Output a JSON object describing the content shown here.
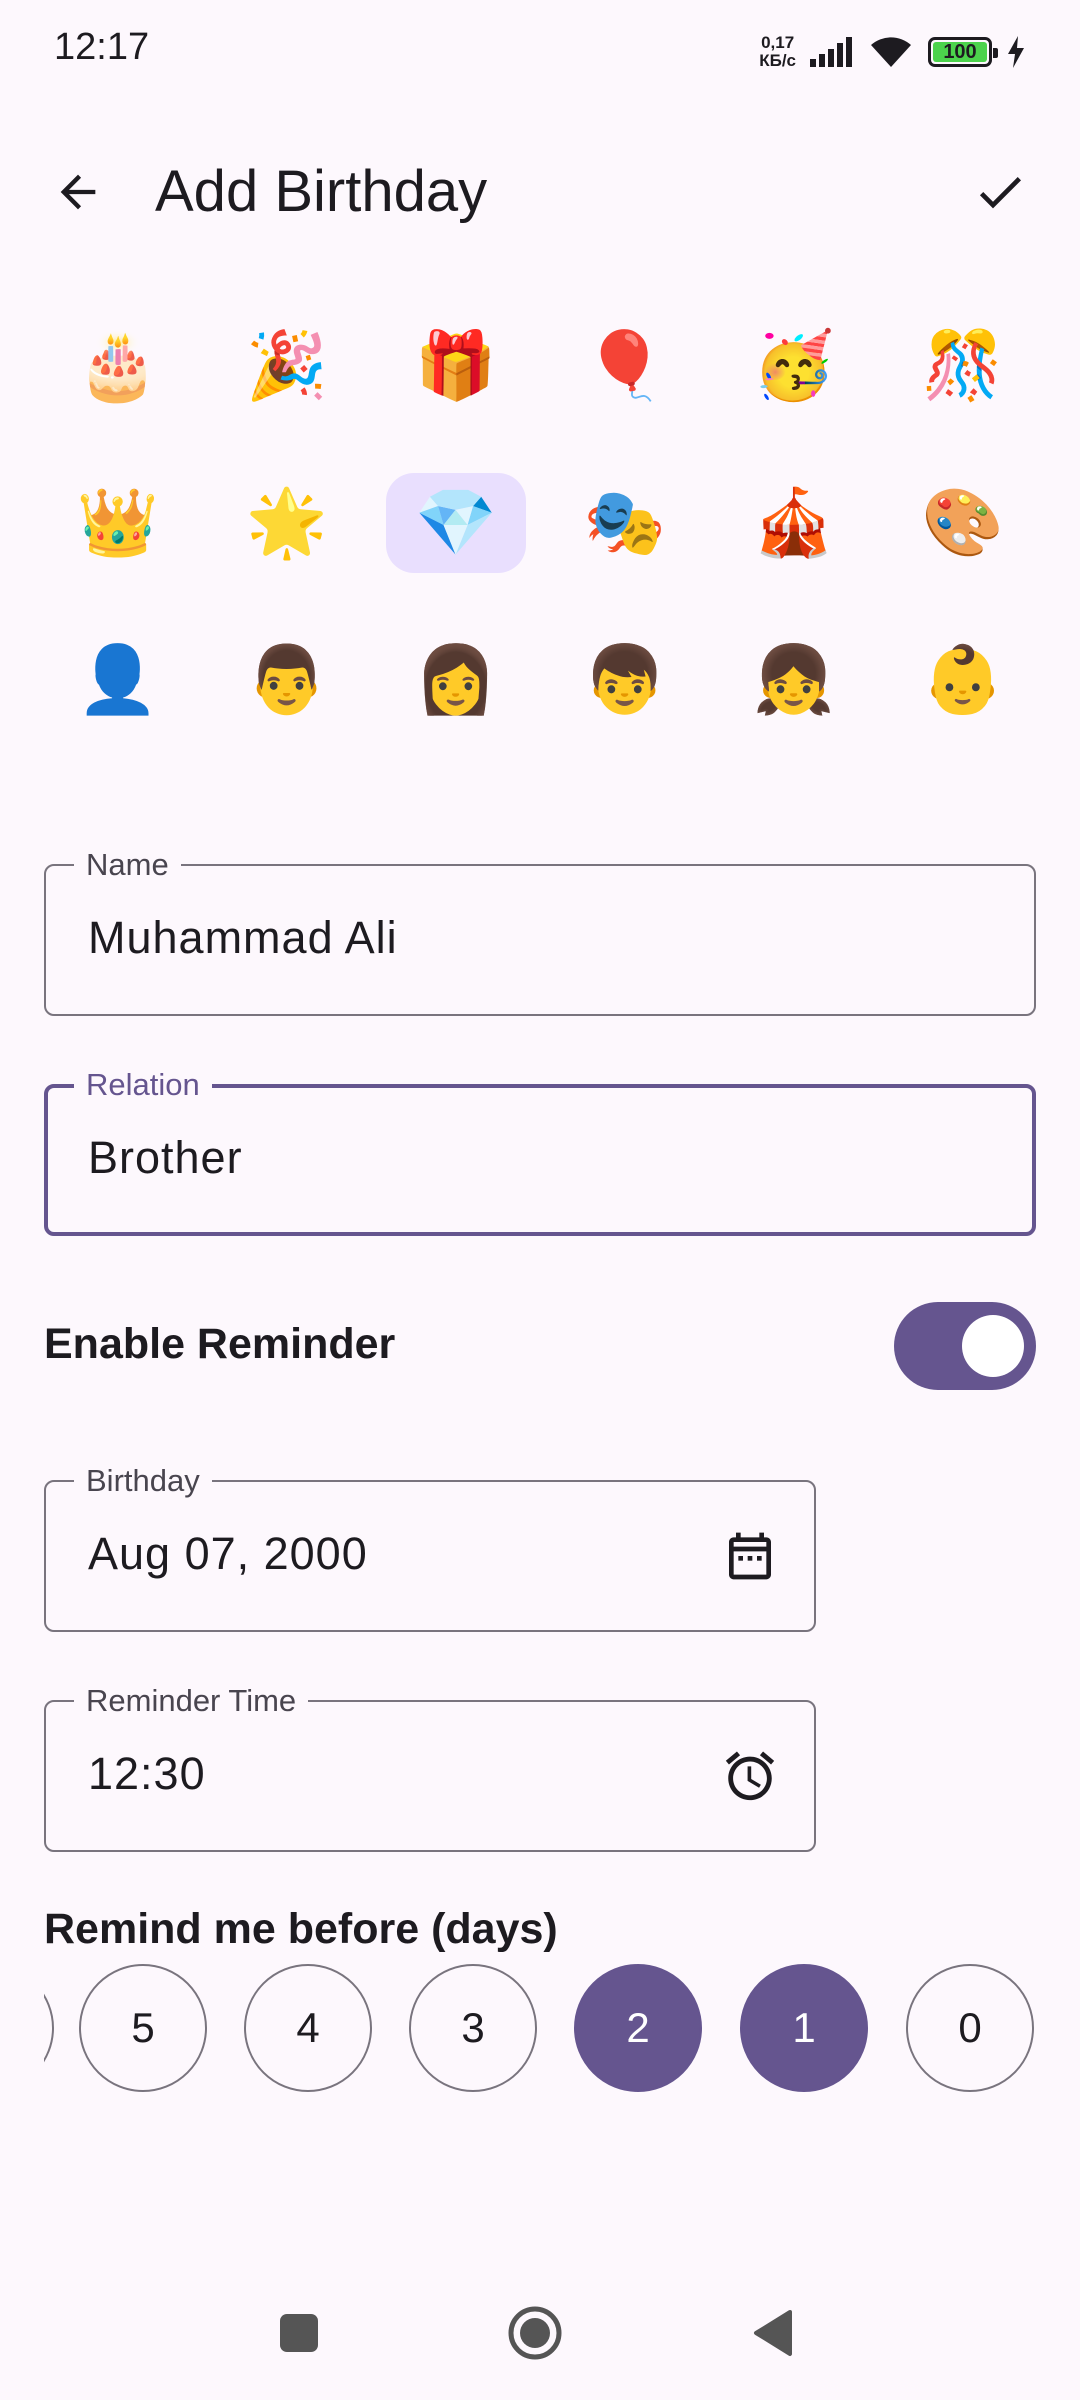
{
  "status_bar": {
    "time": "12:17",
    "net_speed_value": "0,17",
    "net_speed_unit": "КБ/с",
    "battery": "100"
  },
  "app_bar": {
    "title": "Add Birthday",
    "back_icon": "arrow-back-icon",
    "save_icon": "check-icon"
  },
  "emojis": [
    "🎂",
    "🎉",
    "🎁",
    "🎈",
    "🥳",
    "🎊",
    "👑",
    "🌟",
    "💎",
    "🎭",
    "🎪",
    "🎨",
    "👤",
    "👨",
    "👩",
    "👦",
    "👧",
    "👶"
  ],
  "selected_emoji": "💎",
  "form": {
    "name_label": "Name",
    "name_value": "Muhammad Ali",
    "relation_label": "Relation",
    "relation_value": "Brother",
    "reminder_label": "Enable Reminder",
    "reminder_enabled": true,
    "birthday_label": "Birthday",
    "birthday_value": "Aug 07, 2000",
    "birthday_icon": "calendar-icon",
    "time_label": "Reminder Time",
    "time_value": "12:30",
    "time_icon": "alarm-icon",
    "days_title": "Remind me before (days)",
    "days": [
      "5",
      "4",
      "3",
      "2",
      "1",
      "0"
    ],
    "selected_days": [
      "2",
      "1"
    ]
  },
  "colors": {
    "accent": "#65558f",
    "selected_emoji_bg": "#e9dffe",
    "background": "#fdf8fd"
  }
}
